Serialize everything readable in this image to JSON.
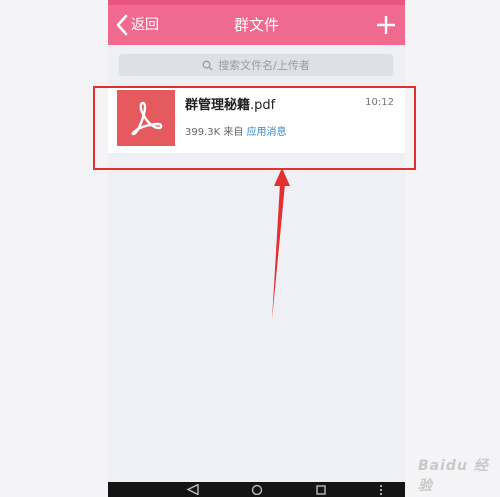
{
  "header": {
    "back_label": "返回",
    "title": "群文件"
  },
  "search": {
    "placeholder": "搜索文件名/上传者"
  },
  "file": {
    "name": "群管理秘籍",
    "ext": ".pdf",
    "time": "10:12",
    "size": "399.3K",
    "from_label": "来自",
    "source": "应用消息",
    "icon": "pdf-icon"
  },
  "watermark": "Baidu 经验",
  "colors": {
    "header": "#f06a8f",
    "pdf_icon": "#e45a5f",
    "link": "#2c8cd6",
    "highlight": "#e0302f"
  }
}
